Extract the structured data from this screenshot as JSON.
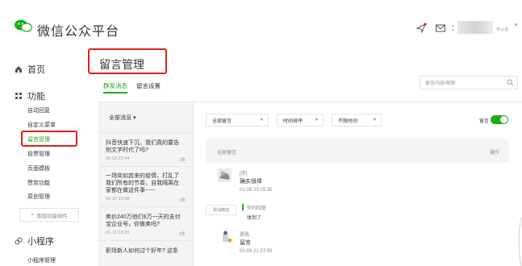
{
  "header": {
    "app_title": "微信公众平台",
    "icons": [
      "location-icon",
      "mail-icon"
    ],
    "user_prefix": ":",
    "user_sub": "未认证",
    "caret": "▾"
  },
  "sidebar": {
    "home": "首页",
    "section_features": "功能",
    "items": [
      {
        "label": "自动回复"
      },
      {
        "label": "自定义菜单"
      },
      {
        "label": "留言管理",
        "active": true
      },
      {
        "label": "投票管理"
      },
      {
        "label": "页面模板"
      },
      {
        "label": "赞赏功能"
      },
      {
        "label": "原创管理"
      }
    ],
    "add_plugin": "添加功能插件",
    "section_mini": "小程序",
    "mini_item": "小程序管理"
  },
  "main": {
    "page_title": "留言管理",
    "tabs": [
      {
        "label": "群发消息",
        "active": true
      },
      {
        "label": "留言设置",
        "active": false
      }
    ],
    "search_placeholder": "留言内容/昵称"
  },
  "message_list": {
    "filter": "全部消息",
    "items": [
      {
        "title_line1": "抖音快速下沉，我们真的要告",
        "title_line2": "别文字时代了吗?",
        "date": "02-12 22:44",
        "count": "1条"
      },
      {
        "title_line1": "一场突如其来的疫情，打乱了",
        "title_line2": "我们所有的节奏，自我隔离在",
        "title_line3": "家都在做这件事~~~",
        "date": "02-12 10:58",
        "count": "1条"
      },
      {
        "title_line1": "卖价240万他们8万一天的支付",
        "title_line2": "宝企业号，你做卖吗?",
        "date": "01-11 19:39",
        "count": "2条"
      },
      {
        "title_line1": "职场新人如何过个好年? 这条"
      }
    ]
  },
  "filters": {
    "comment_type": "全部留言",
    "sort": "时间排序",
    "time": "不限时间",
    "toggle_label": "留言",
    "toggle_on": true,
    "toggle_color": "#1aad19"
  },
  "comments_header": {
    "left": "全部留言",
    "right": "操作"
  },
  "comments": [
    {
      "name": "[赤]",
      "text": "确实很棒",
      "time": "01-08 23:05:35"
    },
    {
      "name": "晋帆",
      "text": "留言",
      "time": "01-08 21:37:05"
    }
  ],
  "reply": {
    "button": "取消精选",
    "label": "你的回复",
    "text": "收到了"
  },
  "colors": {
    "accent": "#1aad19",
    "highlight_border": "#e0201a"
  }
}
